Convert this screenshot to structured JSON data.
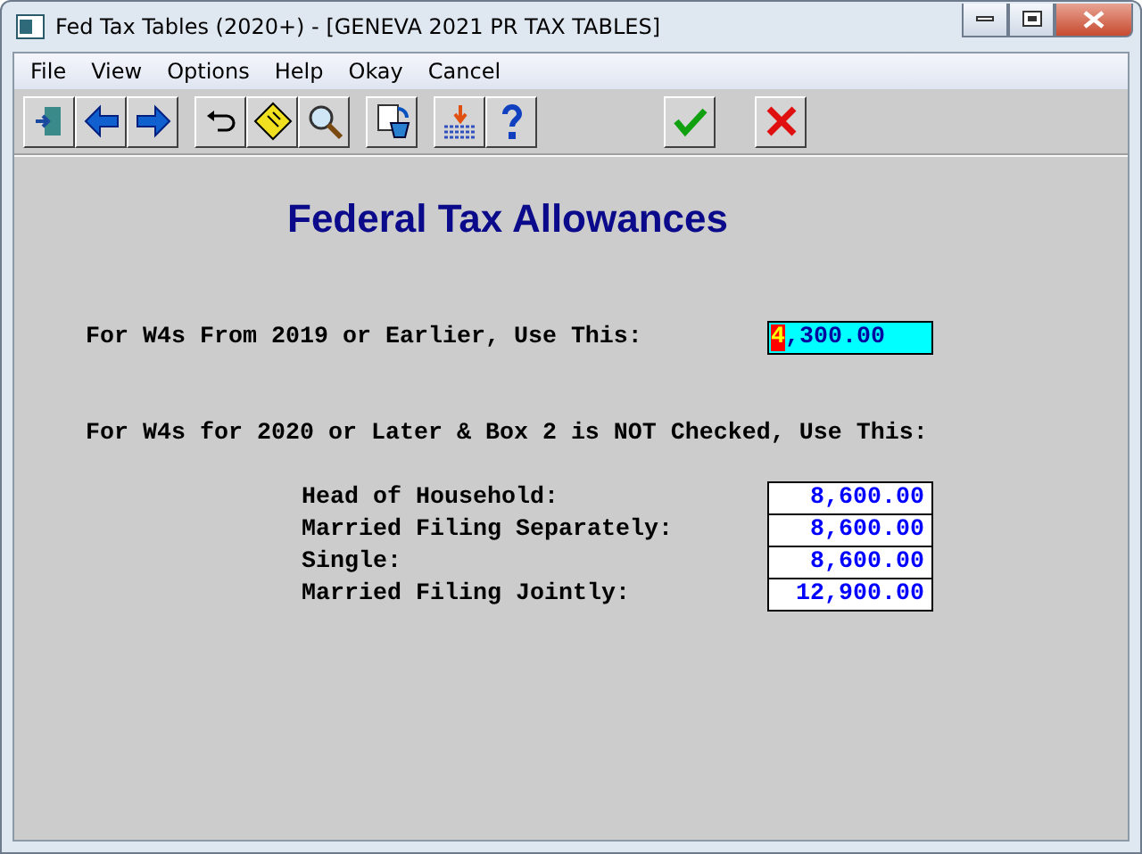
{
  "window": {
    "title": "Fed Tax Tables (2020+) - [GENEVA 2021 PR TAX TABLES]"
  },
  "menu": [
    "File",
    "View",
    "Options",
    "Help",
    "Okay",
    "Cancel"
  ],
  "heading": "Federal Tax Allowances",
  "primary": {
    "label": "For W4s From 2019 or Earlier, Use This:",
    "value": "4,300.00",
    "focused": true
  },
  "section_label": "For W4s for 2020 or Later & Box 2 is NOT Checked, Use This:",
  "rows": [
    {
      "label": "Head of Household:",
      "value": "8,600.00",
      "focused": false
    },
    {
      "label": "Married Filing Separately:",
      "value": "8,600.00",
      "focused": false
    },
    {
      "label": "Single:",
      "value": "8,600.00",
      "focused": false
    },
    {
      "label": "Married Filing Jointly:",
      "value": "12,900.00",
      "focused": false
    }
  ]
}
